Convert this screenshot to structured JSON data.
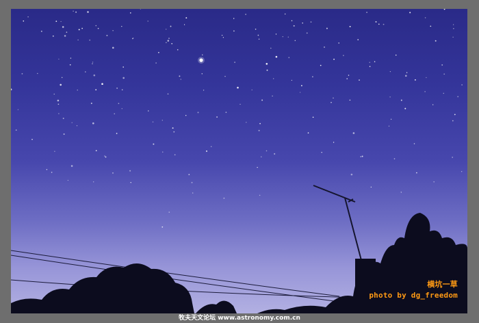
{
  "photo": {
    "caption_cn": "横坑一草",
    "caption_en": "photo by dg_freedom"
  },
  "footer": {
    "credit": "牧夫天文论坛 www.astronomy.com.cn"
  },
  "colors": {
    "frame": "#6e6e6e",
    "sky_top": "#2a2a88",
    "sky_bottom": "#b2b0e2",
    "signature": "#ff9a14"
  }
}
